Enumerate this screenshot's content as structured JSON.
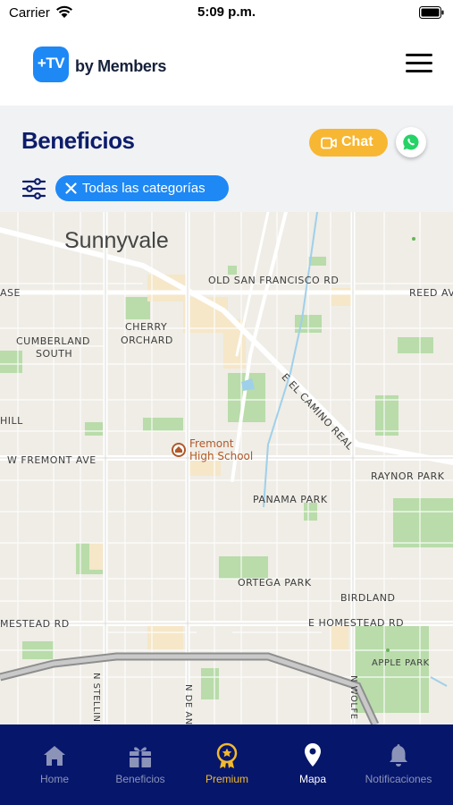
{
  "status_bar": {
    "carrier": "Carrier",
    "time": "5:09 p.m."
  },
  "header": {
    "logo_badge": "+TV",
    "logo_text": "by Members"
  },
  "benefits": {
    "title": "Beneficios",
    "chat_label": "Chat",
    "category_filter": "Todas las categorías"
  },
  "map": {
    "city": "Sunnyvale",
    "labels": {
      "old_san_francisco": "OLD SAN FRANCISCO RD",
      "reed": "REED AV",
      "ase": "ASE",
      "cherry": "CHERRY",
      "orchard": "ORCHARD",
      "cumberland": "CUMBERLAND",
      "south": "SOUTH",
      "el_camino": "E EL CAMINO REAL",
      "hill": "HILL",
      "fremont_school_1": "Fremont",
      "fremont_school_2": "High School",
      "w_fremont": "W FREMONT AVE",
      "raynor": "RAYNOR PARK",
      "panama": "PANAMA PARK",
      "ortega": "ORTEGA PARK",
      "birdland": "BIRDLAND",
      "mestead": "MESTEAD RD",
      "e_homestead": "E HOMESTEAD RD",
      "apple_park": "APPLE PARK",
      "n_stelling": "N STELLIN",
      "n_de_anza": "N DE AN",
      "n_wolfe": "N WOLFE"
    }
  },
  "bottom_nav": {
    "items": [
      {
        "label": "Home",
        "icon": "home-icon"
      },
      {
        "label": "Beneficios",
        "icon": "gift-icon"
      },
      {
        "label": "Premium",
        "icon": "medal-icon"
      },
      {
        "label": "Mapa",
        "icon": "map-pin-icon"
      },
      {
        "label": "Notificaciones",
        "icon": "bell-icon"
      }
    ]
  },
  "colors": {
    "brand_blue": "#1e88f5",
    "title_navy": "#0d1d6b",
    "nav_background": "#06166b",
    "chat_orange": "#f7b733",
    "premium_gold": "#f2b92d"
  }
}
